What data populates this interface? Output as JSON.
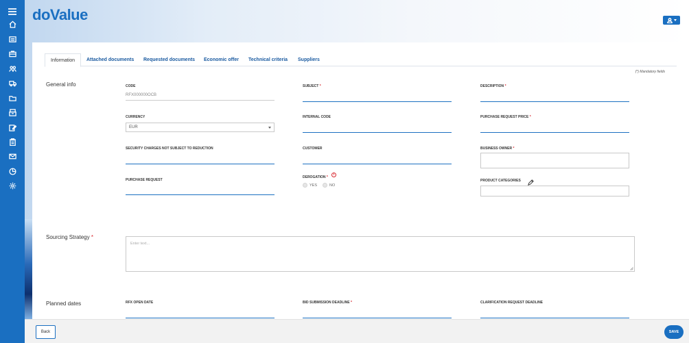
{
  "app": {
    "logo": "doValue"
  },
  "sidebar": {
    "items": [
      {
        "icon": "menu-icon"
      },
      {
        "icon": "home-icon"
      },
      {
        "icon": "list-icon"
      },
      {
        "icon": "briefcase-icon"
      },
      {
        "icon": "users-icon"
      },
      {
        "icon": "truck-icon"
      },
      {
        "icon": "folder-icon"
      },
      {
        "icon": "archive-icon"
      },
      {
        "icon": "edit-icon"
      },
      {
        "icon": "clipboard-icon"
      },
      {
        "icon": "mail-icon"
      },
      {
        "icon": "chart-icon"
      },
      {
        "icon": "gear-icon"
      }
    ]
  },
  "tabs": [
    {
      "label": "Information",
      "active": true
    },
    {
      "label": "Attached documents"
    },
    {
      "label": "Requested documents"
    },
    {
      "label": "Economic offer"
    },
    {
      "label": "Technical criteria"
    },
    {
      "label": "Suppliers"
    }
  ],
  "mandatory_note": "(*) Mandatory fields",
  "sections": {
    "general_info": "General info",
    "sourcing_strategy": "Sourcing Strategy",
    "planned_dates": "Planned dates"
  },
  "fields": {
    "code": {
      "label": "CODE",
      "value": "RFX000000OCB"
    },
    "subject": {
      "label": "SUBJECT"
    },
    "description": {
      "label": "DESCRIPTION"
    },
    "currency": {
      "label": "CURRENCY",
      "value": "EUR"
    },
    "internal_code": {
      "label": "INTERNAL CODE"
    },
    "purchase_request_price": {
      "label": "PURCHASE REQUEST PRICE"
    },
    "security_charges": {
      "label": "SECURITY CHARGES NOT SUBJECT TO REDUCTION"
    },
    "customer": {
      "label": "CUSTOMER"
    },
    "business_owner": {
      "label": "BUSINESS OWNER"
    },
    "purchase_request": {
      "label": "PURCHASE REQUEST"
    },
    "derogation": {
      "label": "DEROGATION",
      "options": [
        "YES",
        "NO"
      ]
    },
    "product_categories": {
      "label": "PRODUCT CATEGORIES"
    },
    "sourcing_strategy": {
      "placeholder": "Enter text..."
    },
    "rfx_open_date": {
      "label": "RFX OPEN DATE"
    },
    "bid_submission_deadline": {
      "label": "BID SUBMISSION DEADLINE"
    },
    "clarification_request_deadline": {
      "label": "CLARIFICATION REQUEST DEADLINE"
    }
  },
  "required_marker": "*",
  "info_glyph": "i",
  "footer": {
    "back_label": "Back",
    "save_label": "SAVE"
  },
  "colors": {
    "primary": "#1a6fc1",
    "required": "#d8282f"
  }
}
